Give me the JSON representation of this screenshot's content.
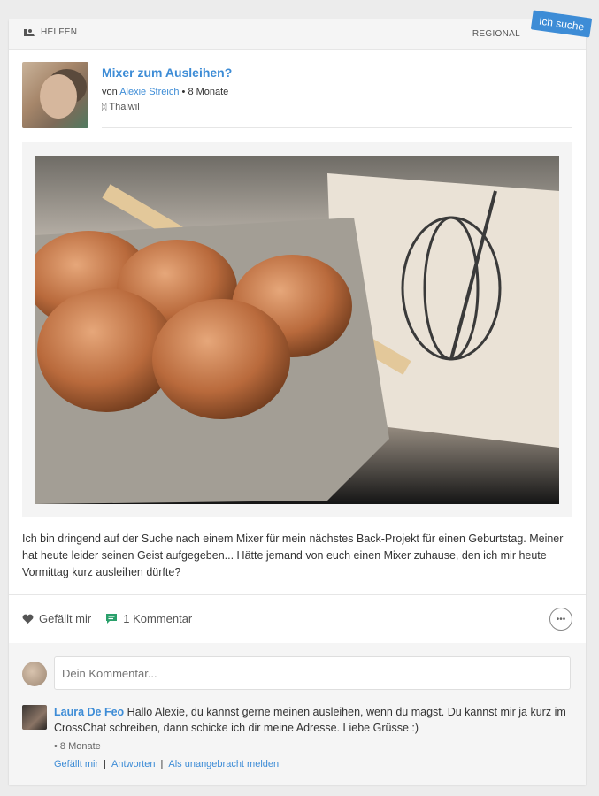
{
  "header": {
    "category": "HELFEN",
    "region": "REGIONAL",
    "tag": "Ich suche"
  },
  "post": {
    "title": "Mixer zum Ausleihen?",
    "by_prefix": "von",
    "author": "Alexie Streich",
    "age": "• 8 Monate",
    "location": "Thalwil",
    "text": "Ich bin dringend auf der Suche nach einem Mixer für mein nächstes Back-Projekt für einen Geburtstag. Meiner hat heute leider seinen Geist aufgegeben... Hätte jemand von euch einen Mixer zuhause, den ich mir heute Vormittag kurz ausleihen dürfte?"
  },
  "actions": {
    "like": "Gefällt mir",
    "comments": "1 Kommentar"
  },
  "comment_box": {
    "placeholder": "Dein Kommentar..."
  },
  "reply": {
    "name": "Laura De Feo",
    "text": "Hallo Alexie, du kannst gerne meinen ausleihen, wenn du magst. Du kannst mir ja kurz im CrossChat schreiben, dann schicke ich dir meine Adresse. Liebe Grüsse :)",
    "time": "• 8 Monate",
    "like": "Gefällt mir",
    "answer": "Antworten",
    "report": "Als unangebracht melden"
  },
  "colors": {
    "accent": "#3d8cd6",
    "comment_icon": "#2aa06b"
  },
  "icons": [
    "helping-hand-icon",
    "map-pin-icon",
    "heart-icon",
    "comment-icon",
    "more-options-icon"
  ]
}
